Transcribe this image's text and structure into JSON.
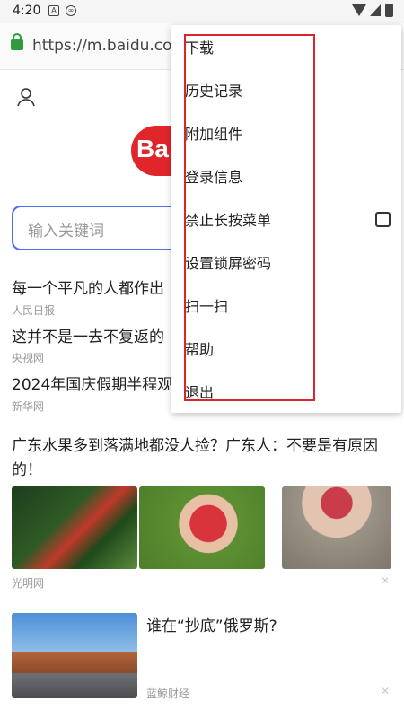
{
  "status_bar": {
    "time": "4:20",
    "icons": [
      "notification-a-icon",
      "notification-infinity-icon",
      "wifi-icon",
      "signal-icon",
      "battery-icon"
    ]
  },
  "browser": {
    "url": "https://m.baidu.com/?"
  },
  "page": {
    "logo_text": "Ba",
    "search_placeholder": "输入关键词",
    "news": [
      {
        "title": "每一个平凡的人都作出",
        "source": "人民日报"
      },
      {
        "title": "这并不是一去不复返的",
        "source": "央视网"
      },
      {
        "title": "2024年国庆假期半程观",
        "source": "新华网"
      }
    ],
    "feed": [
      {
        "title": "广东水果多到落满地都没人捡？广东人：不要是有原因的！",
        "source": "光明网",
        "close": "✕"
      },
      {
        "title": "谁在“抄底”俄罗斯?",
        "source": "蓝鲸财经",
        "close": "✕"
      }
    ]
  },
  "menu": {
    "items": [
      "下载",
      "历史记录",
      "附加组件",
      "登录信息",
      "禁止长按菜单",
      "设置锁屏密码",
      "扫一扫",
      "帮助",
      "退出"
    ],
    "checkbox_checked": false
  },
  "colors": {
    "highlight": "#d9262c",
    "accent": "#4e6ef2",
    "lock": "#2e9b3f"
  }
}
